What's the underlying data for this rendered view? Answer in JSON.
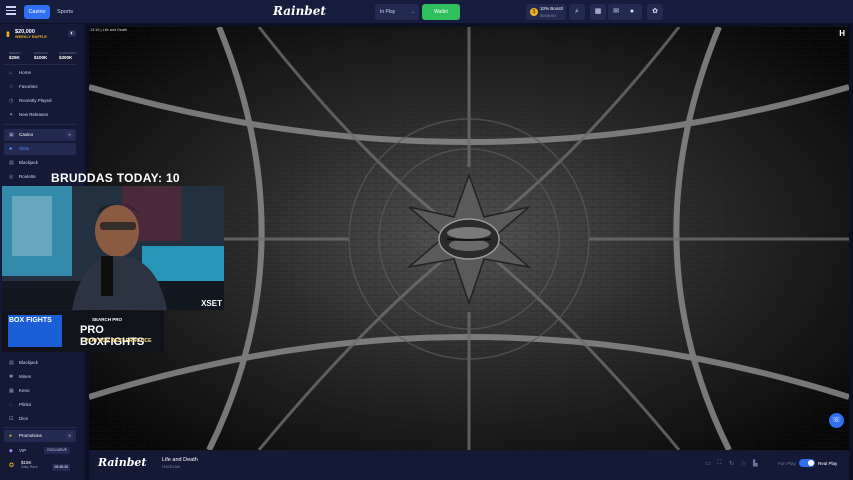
{
  "topbar": {
    "tabs": [
      "Casino",
      "Sports"
    ],
    "logo": "Rainbet",
    "balance_label": "In Play",
    "wallet_label": "Wallet",
    "boost": {
      "title": "10% Boost!",
      "subtitle": "00:00:00"
    }
  },
  "sidebar": {
    "raffle": {
      "amount": "$20,000",
      "label": "WEEKLY RAFFLE",
      "prizes": [
        {
          "label": "WEEKLY",
          "value": "$25K"
        },
        {
          "label": "MONTHLY",
          "value": "$100K"
        },
        {
          "label": "QUARTERLY",
          "value": "$300K"
        }
      ]
    },
    "top_items": [
      "Home",
      "Favorites",
      "Recently Played",
      "New Releases"
    ],
    "casino_label": "Casino",
    "casino_items": [
      "Slots",
      "Blackjack",
      "Roulette"
    ],
    "originals": [
      "Blackjack",
      "Mines",
      "Keno",
      "Plinko",
      "Dice"
    ],
    "promotions_label": "Promotions",
    "vip": {
      "label": "VIP",
      "badge": "EXCLUSIVE"
    },
    "daily": {
      "amount": "$15K",
      "label": "Daily Race",
      "timer": "05:45:30"
    }
  },
  "game": {
    "title_bar": "13:16 | Life and Death",
    "name": "Life and Death",
    "provider": "Hacksaw"
  },
  "bottombar": {
    "fun_play": "Fun Play",
    "real_play": "Real Play"
  },
  "overlay": {
    "counter": "BRUDDAS TODAY: 10",
    "webcam_brand": "XSET",
    "banner_left": "BOX FIGHTS",
    "banner_search": "SEARCH PRO",
    "banner_title": "PRO BOXFIGHTS",
    "banner_sub": "PLAY FOR BEST PRACTICE"
  },
  "colors": {
    "accent": "#2f6ff2",
    "wallet": "#2fbf5c",
    "bg": "#0b1024",
    "panel": "#141a36"
  }
}
